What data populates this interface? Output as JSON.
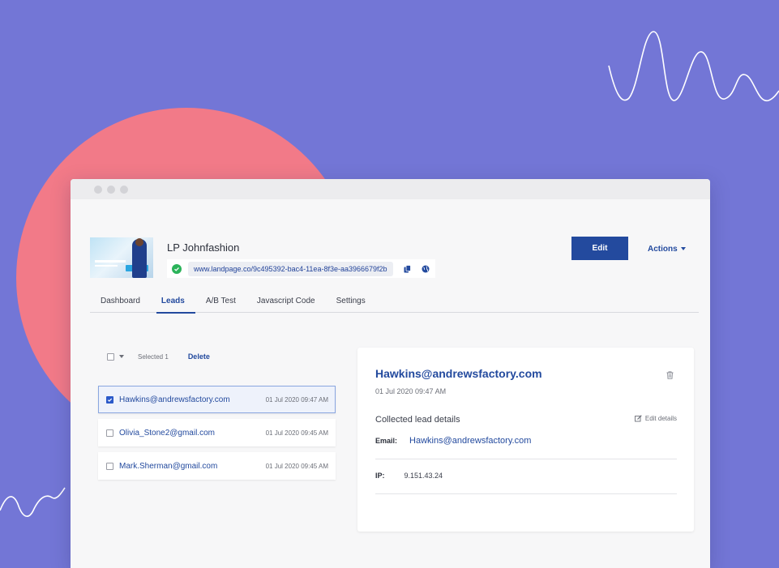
{
  "page": {
    "title": "LP Johnfashion",
    "url": "www.landpage.co/9c495392-bac4-11ea-8f3e-aa3966679f2b",
    "edit_label": "Edit",
    "actions_label": "Actions"
  },
  "tabs": [
    {
      "label": "Dashboard",
      "active": false
    },
    {
      "label": "Leads",
      "active": true
    },
    {
      "label": "A/B Test",
      "active": false
    },
    {
      "label": "Javascript Code",
      "active": false
    },
    {
      "label": "Settings",
      "active": false
    }
  ],
  "list_toolbar": {
    "selected_text": "Selected 1",
    "delete_label": "Delete"
  },
  "leads": [
    {
      "email": "Hawkins@andrewsfactory.com",
      "date": "01 Jul 2020 09:47 AM",
      "checked": true
    },
    {
      "email": "Olivia_Stone2@gmail.com",
      "date": "01 Jul 2020 09:45 AM",
      "checked": false
    },
    {
      "email": "Mark.Sherman@gmail.com",
      "date": "01 Jul 2020 09:45 AM",
      "checked": false
    }
  ],
  "detail": {
    "email": "Hawkins@andrewsfactory.com",
    "date": "01 Jul 2020 09:47 AM",
    "section_title": "Collected lead details",
    "edit_details_label": "Edit details",
    "email_label": "Email:",
    "email_value": "Hawkins@andrewsfactory.com",
    "ip_label": "IP:",
    "ip_value": "9.151.43.24"
  },
  "colors": {
    "background": "#7376d6",
    "circle": "#f27a88",
    "accent": "#234a9e",
    "success": "#2bb35a"
  }
}
